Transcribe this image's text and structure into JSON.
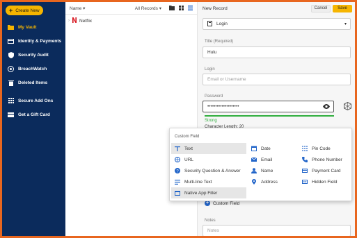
{
  "sidebar": {
    "create_label": "Create New",
    "items": [
      {
        "label": "My Vault",
        "icon": "folder-icon",
        "active": true
      },
      {
        "label": "Identity & Payments",
        "icon": "id-card-icon"
      },
      {
        "label": "Security Audit",
        "icon": "shield-icon"
      },
      {
        "label": "BreachWatch",
        "icon": "radar-icon"
      },
      {
        "label": "Deleted Items",
        "icon": "trash-icon"
      },
      {
        "label": "Secure Add Ons",
        "icon": "grid-icon"
      },
      {
        "label": "Get a Gift Card",
        "icon": "gift-card-icon"
      }
    ]
  },
  "list": {
    "name_header": "Name ▾",
    "filter_label": "All Records ▾",
    "records": [
      {
        "name": "Netflix"
      }
    ]
  },
  "panel": {
    "title": "New Record",
    "cancel_label": "Cancel",
    "save_label": "Save",
    "record_type": "Login",
    "title_label": "Title (Required)",
    "title_value": "Hulu",
    "login_label": "Login",
    "login_placeholder": "Email or Username",
    "password_label": "Password",
    "password_value": "••••••••••••••••••••",
    "strength_label": "Strong",
    "char_length": "Character Length: 20",
    "custom_field_label": "Custom Field",
    "notes_label": "Notes",
    "notes_placeholder": "Notes"
  },
  "popup": {
    "title": "Custom Field",
    "col1": [
      {
        "label": "Text",
        "icon": "text-icon",
        "highlight": true
      },
      {
        "label": "URL",
        "icon": "globe-icon"
      },
      {
        "label": "Security Question & Answer",
        "icon": "question-icon"
      },
      {
        "label": "Multi-line Text",
        "icon": "multiline-icon"
      },
      {
        "label": "Native App Filler",
        "icon": "app-window-icon",
        "highlight": true
      }
    ],
    "col2": [
      {
        "label": "Date",
        "icon": "calendar-icon"
      },
      {
        "label": "Email",
        "icon": "envelope-icon"
      },
      {
        "label": "Name",
        "icon": "person-icon"
      },
      {
        "label": "Address",
        "icon": "map-pin-icon"
      }
    ],
    "col3": [
      {
        "label": "Pin Code",
        "icon": "keypad-icon"
      },
      {
        "label": "Phone Number",
        "icon": "phone-icon"
      },
      {
        "label": "Payment Card",
        "icon": "credit-card-icon"
      },
      {
        "label": "Hidden Field",
        "icon": "hidden-field-icon"
      }
    ]
  },
  "colors": {
    "sidebar_bg": "#0b2b5c",
    "accent": "#f6b500",
    "frame_border": "#e8661f",
    "strength": "#2fae3d",
    "icon_blue": "#2265c9"
  }
}
